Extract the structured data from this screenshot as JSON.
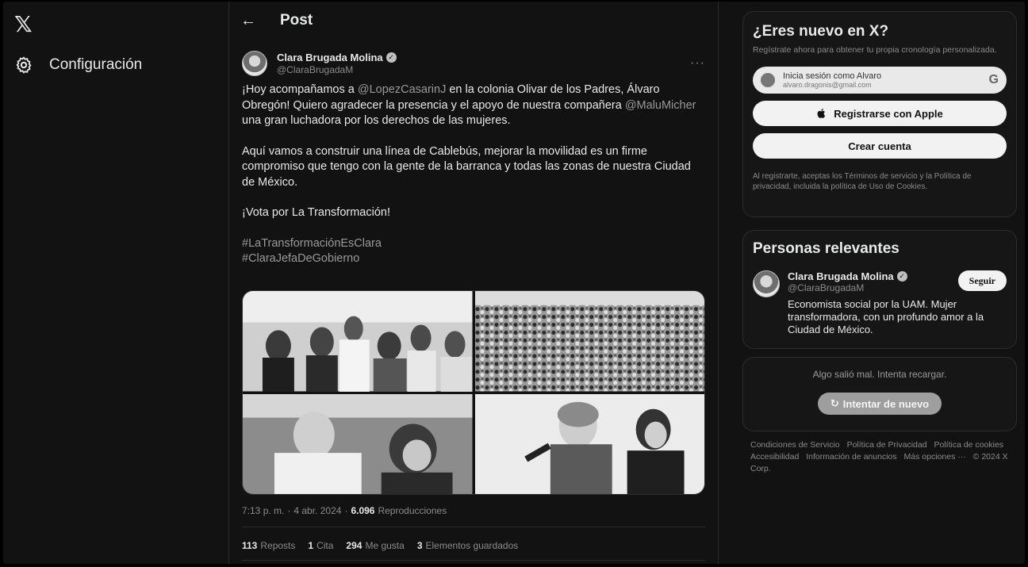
{
  "nav": {
    "logo": "𝕏",
    "settings_label": "Configuración"
  },
  "post": {
    "header_title": "Post",
    "author_name": "Clara Brugada Molina",
    "author_handle": "@ClaraBrugadaM",
    "more_label": "···",
    "p1_a": "¡Hoy acompañamos a ",
    "p1_mention1": "@LopezCasarinJ",
    "p1_b": " en la colonia Olivar de los Padres, Álvaro Obregón! Quiero agradecer la presencia y el apoyo de nuestra compañera ",
    "p1_mention2": "@MaluMicher",
    "p1_c": " una gran luchadora por los derechos de las mujeres.",
    "p2": "Aquí vamos a construir una línea de Cablebús, mejorar la movilidad es un firme compromiso que tengo con la gente de la barranca y todas las zonas de nuestra Ciudad de México.",
    "p3": "¡Vota por La Transformación!",
    "hashtag1": "#LaTransformaciónEsClara",
    "hashtag2": "#ClaraJefaDeGobierno",
    "time": "7:13 p. m.",
    "date": "4 abr. 2024",
    "views_count": "6.096",
    "views_label": "Reproducciones",
    "reposts_count": "113",
    "reposts_label": "Reposts",
    "quotes_count": "1",
    "quotes_label": "Cita",
    "likes_count": "294",
    "likes_label": "Me gusta",
    "saves_count": "3",
    "saves_label": "Elementos guardados"
  },
  "signup": {
    "title": "¿Eres nuevo en X?",
    "subtitle": "Regístrate ahora para obtener tu propia cronología personalizada.",
    "google_line1": "Inicia sesión como Alvaro",
    "google_line2": "alvaro.dragonis@gmail.com",
    "google_mark": "G",
    "apple_label": "Registrarse con Apple",
    "create_label": "Crear cuenta",
    "legal": "Al registrarte, aceptas los Términos de servicio y la Política de privacidad, incluida la política de Uso de Cookies."
  },
  "relevant": {
    "title": "Personas relevantes",
    "name": "Clara Brugada Molina",
    "handle": "@ClaraBrugadaM",
    "follow_label": "Seguir",
    "bio": "Economista social por la UAM. Mujer transformadora, con un profundo amor a la Ciudad de México."
  },
  "error_card": {
    "message": "Algo salió mal. Intenta recargar.",
    "retry_label": "Intentar de nuevo"
  },
  "footer": {
    "links": [
      "Condiciones de Servicio",
      "Política de Privacidad",
      "Política de cookies",
      "Accesibilidad",
      "Información de anuncios",
      "Más opciones ···"
    ],
    "copyright": "© 2024 X Corp."
  }
}
